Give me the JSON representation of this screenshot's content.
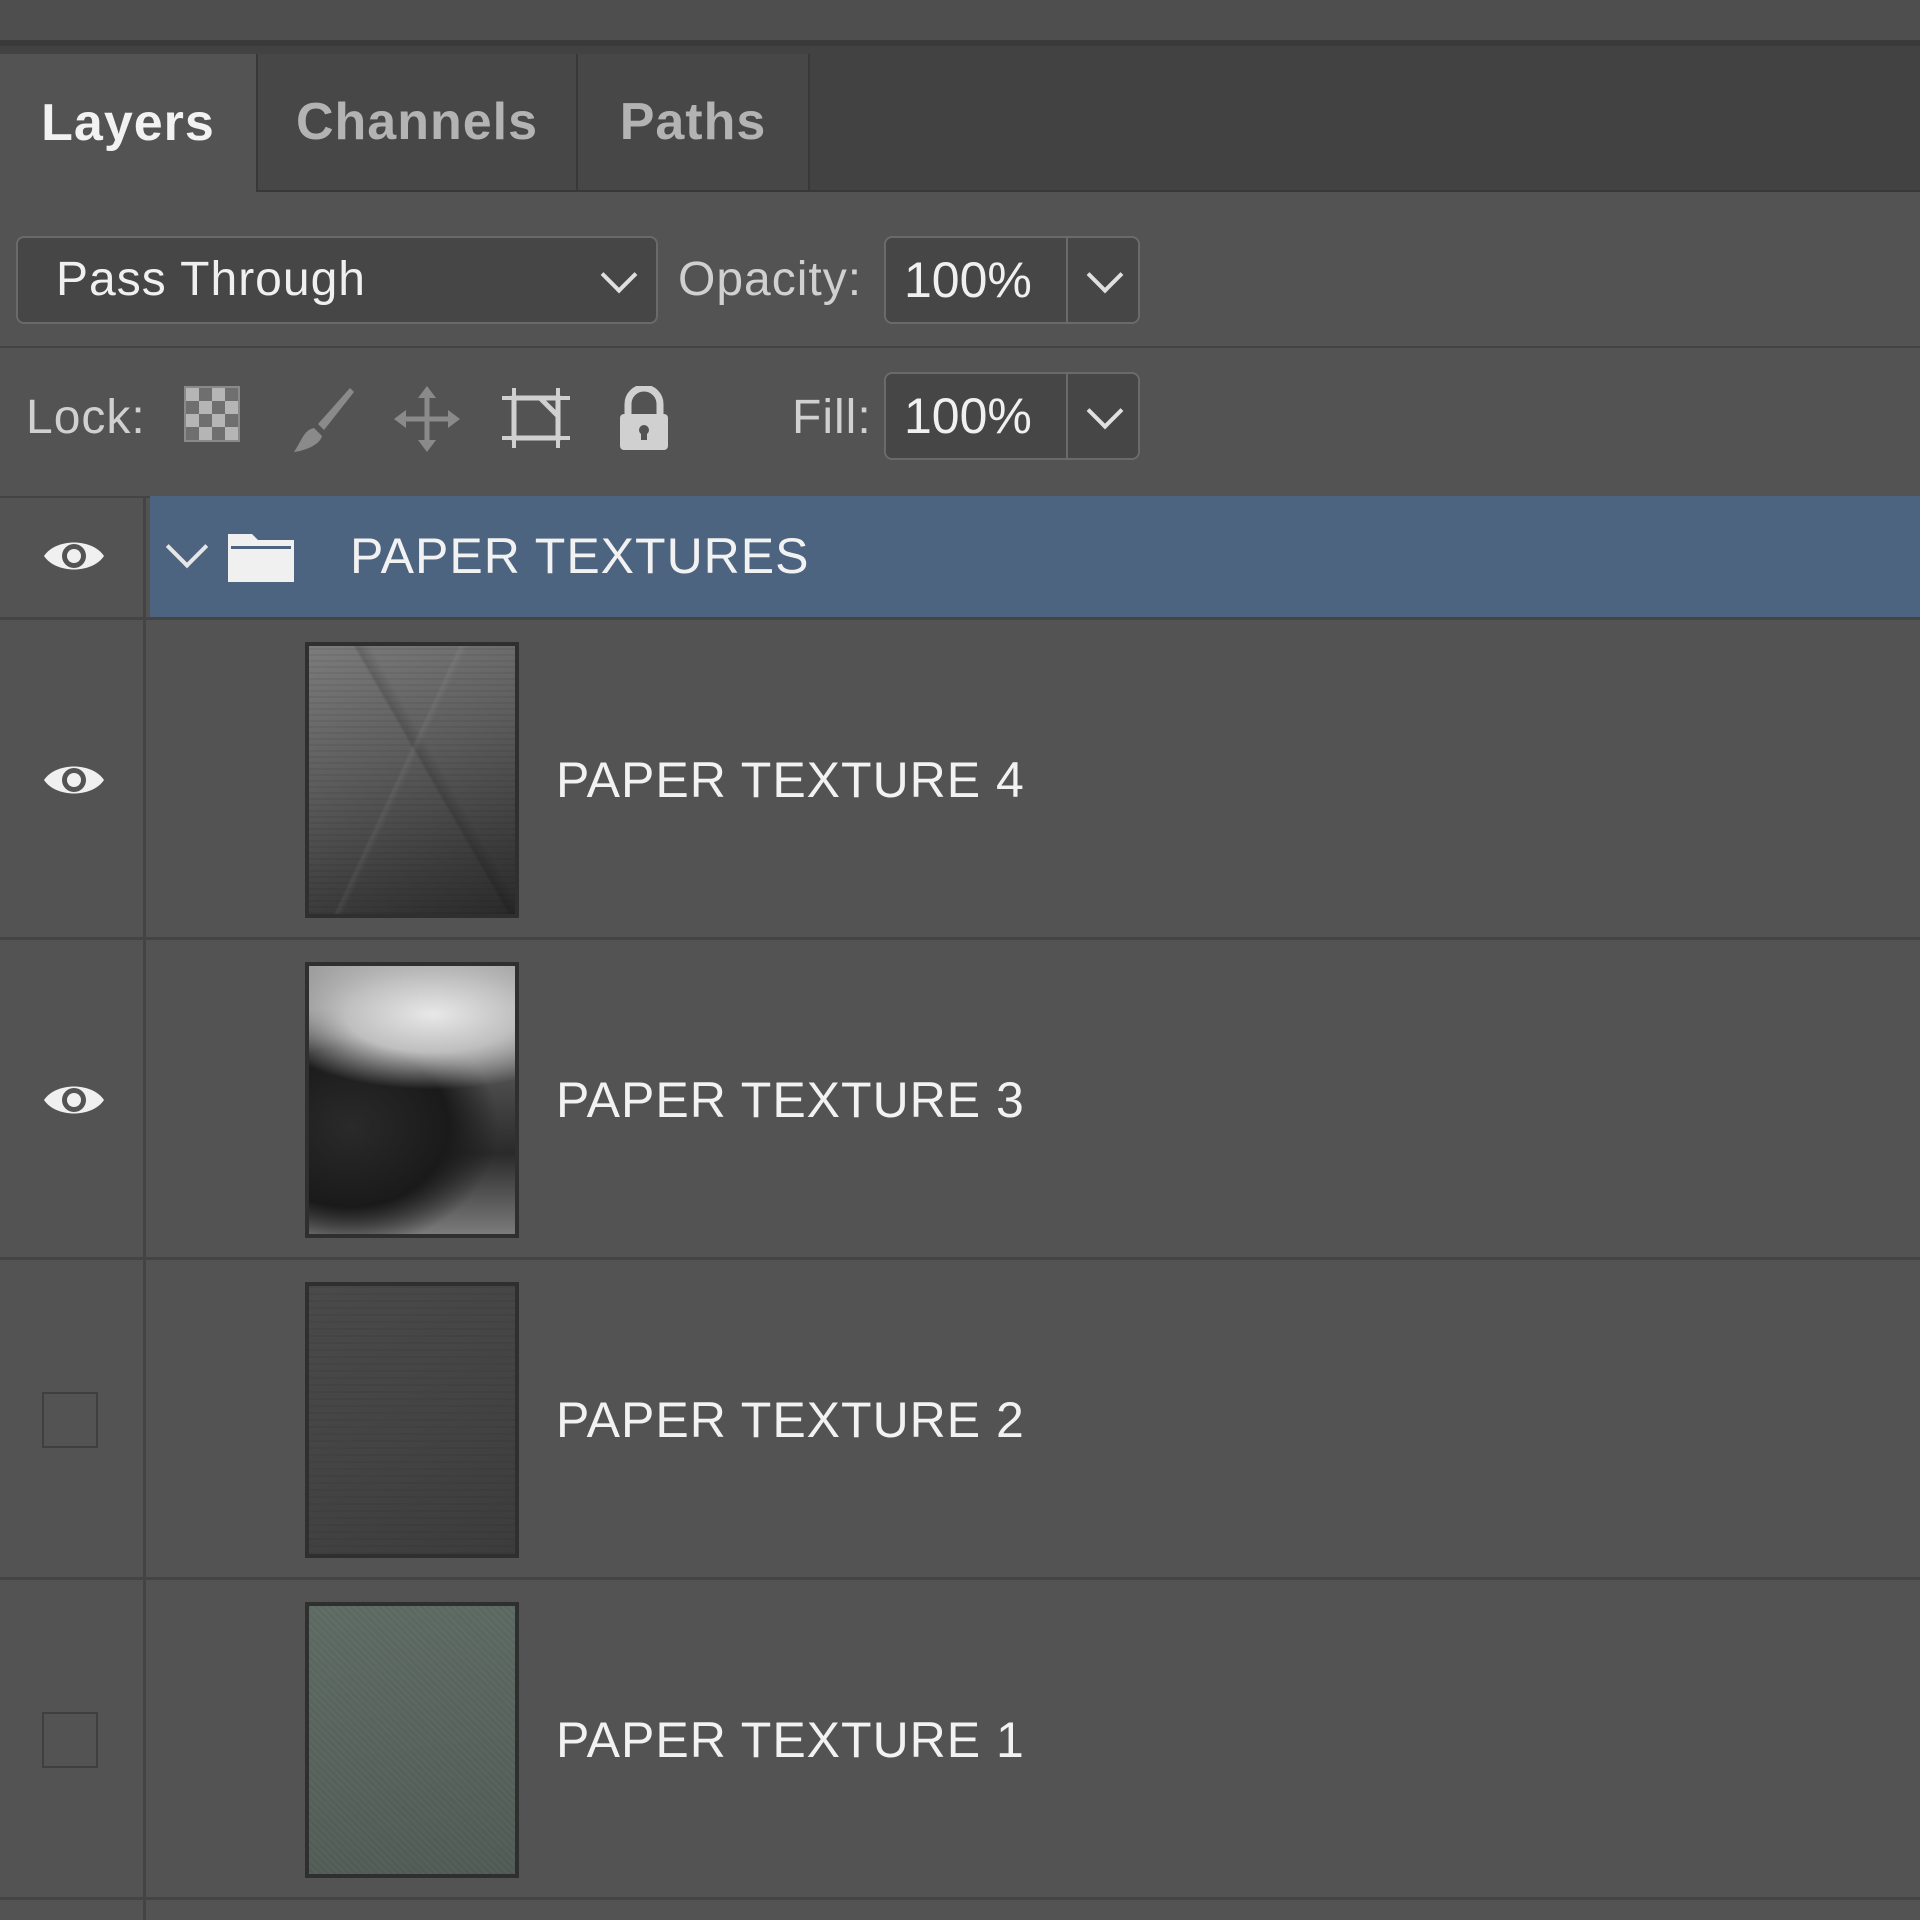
{
  "tabs": [
    {
      "label": "Layers",
      "active": true
    },
    {
      "label": "Channels",
      "active": false
    },
    {
      "label": "Paths",
      "active": false
    }
  ],
  "blend": {
    "mode": "Pass Through"
  },
  "opacity": {
    "label": "Opacity:",
    "value": "100%"
  },
  "lock": {
    "label": "Lock:",
    "icons": [
      "lock-transparent-pixels-icon",
      "lock-image-pixels-icon",
      "lock-position-icon",
      "lock-artboard-icon",
      "lock-all-icon"
    ]
  },
  "fill": {
    "label": "Fill:",
    "value": "100%"
  },
  "group": {
    "name": "PAPER TEXTURES",
    "visible": true,
    "expanded": true,
    "selected": true,
    "highlight_color": "#4c6480"
  },
  "layers": [
    {
      "name": "PAPER TEXTURE 4",
      "visible": true
    },
    {
      "name": "PAPER TEXTURE 3",
      "visible": true
    },
    {
      "name": "PAPER TEXTURE 2",
      "visible": false
    },
    {
      "name": "PAPER TEXTURE 1",
      "visible": false
    }
  ],
  "colors": {
    "panel_bg": "#535353",
    "tab_bar_bg": "#424242",
    "text": "#f2f2f2"
  }
}
